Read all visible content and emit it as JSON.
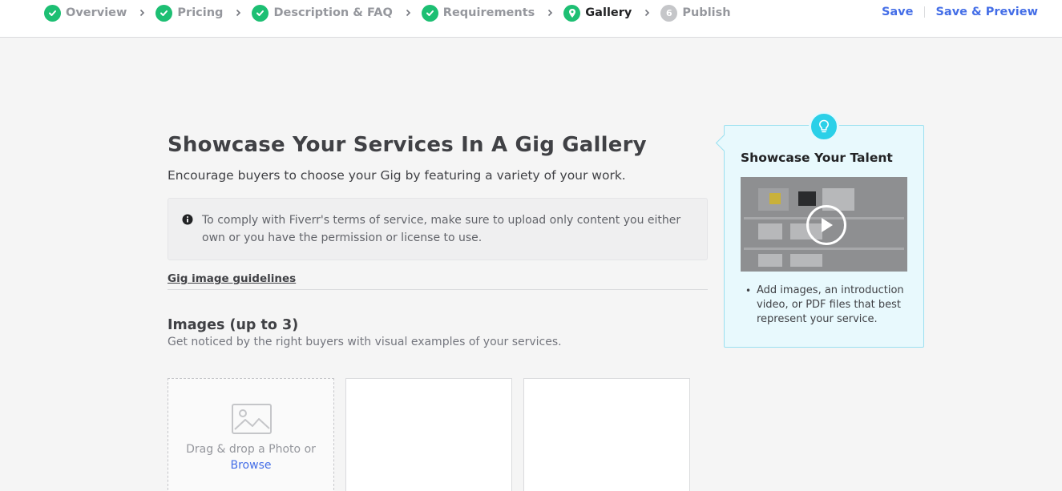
{
  "stepper": {
    "steps": [
      {
        "label": "Overview",
        "state": "done"
      },
      {
        "label": "Pricing",
        "state": "done"
      },
      {
        "label": "Description & FAQ",
        "state": "done"
      },
      {
        "label": "Requirements",
        "state": "done"
      },
      {
        "label": "Gallery",
        "state": "current"
      },
      {
        "label": "Publish",
        "state": "pending",
        "number": "6"
      }
    ],
    "save_label": "Save",
    "save_preview_label": "Save & Preview"
  },
  "main": {
    "title": "Showcase Your Services In A Gig Gallery",
    "subtitle": "Encourage buyers to choose your Gig by featuring a variety of your work.",
    "notice": "To comply with Fiverr's terms of service, make sure to upload only content you either own or you have the permission or license to use.",
    "guidelines_link": "Gig image guidelines",
    "images_section": {
      "title": "Images (up to 3)",
      "description": "Get noticed by the right buyers with visual examples of your services.",
      "drop_text": "Drag & drop a Photo or",
      "browse_label": "Browse"
    }
  },
  "tip": {
    "title": "Showcase Your Talent",
    "bullets": [
      "Add images, an introduction video, or PDF files that best represent your service."
    ]
  },
  "colors": {
    "accent_green": "#1dbf73",
    "link_blue": "#446ee7",
    "tip_cyan": "#2bd0e8"
  }
}
